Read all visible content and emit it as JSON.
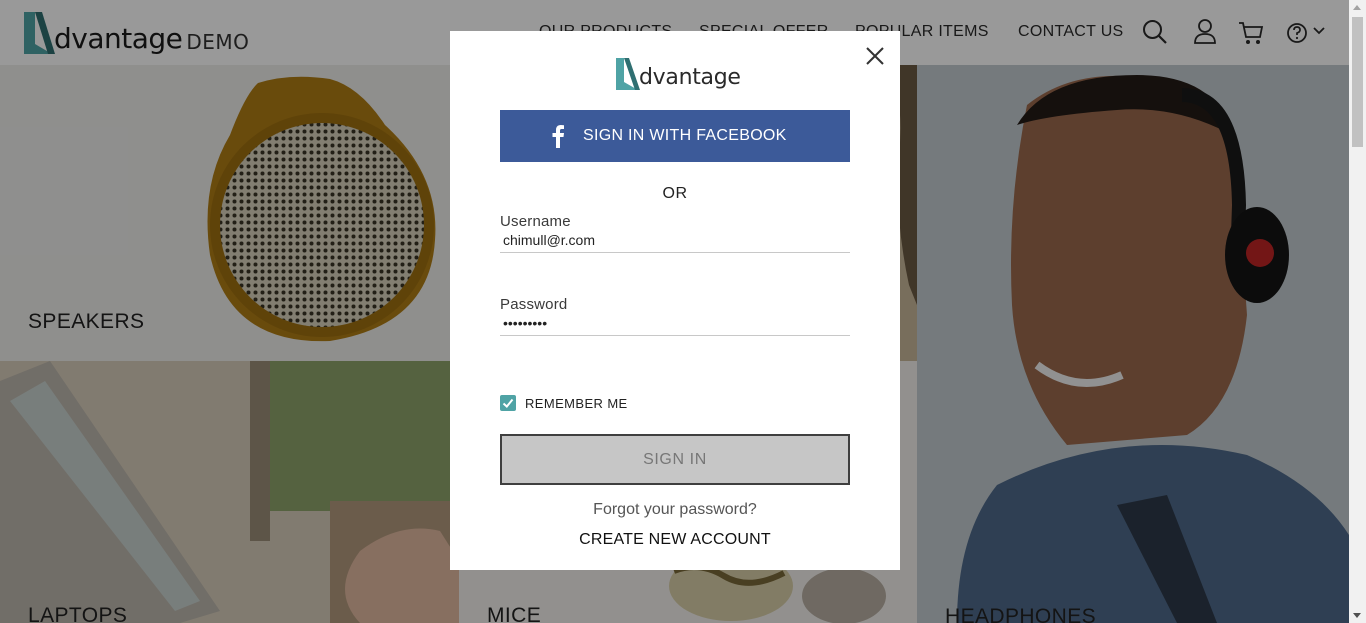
{
  "header": {
    "logo_text": "dvantage",
    "logo_suffix": "DEMO",
    "nav": [
      "OUR PRODUCTS",
      "SPECIAL OFFER",
      "POPULAR ITEMS",
      "CONTACT US"
    ],
    "icons": [
      "search-icon",
      "user-icon",
      "cart-icon",
      "help-icon",
      "chevron-down-icon"
    ]
  },
  "categories": {
    "speakers": "SPEAKERS",
    "laptops": "LAPTOPS",
    "mice": "MICE",
    "headphones": "HEADPHONES"
  },
  "modal": {
    "logo_text": "dvantage",
    "facebook_label": "SIGN IN WITH FACEBOOK",
    "or_text": "OR",
    "username_label": "Username",
    "username_value": "chimull@r.com",
    "password_label": "Password",
    "password_value": "123456789",
    "remember_label": "REMEMBER ME",
    "remember_checked": true,
    "signin_label": "SIGN IN",
    "forgot_label": "Forgot your password?",
    "create_label": "CREATE NEW ACCOUNT"
  },
  "colors": {
    "brand_teal": "#4fa3a5",
    "facebook_blue": "#3c5a99",
    "overlay": "rgba(0,0,0,0.40)"
  }
}
